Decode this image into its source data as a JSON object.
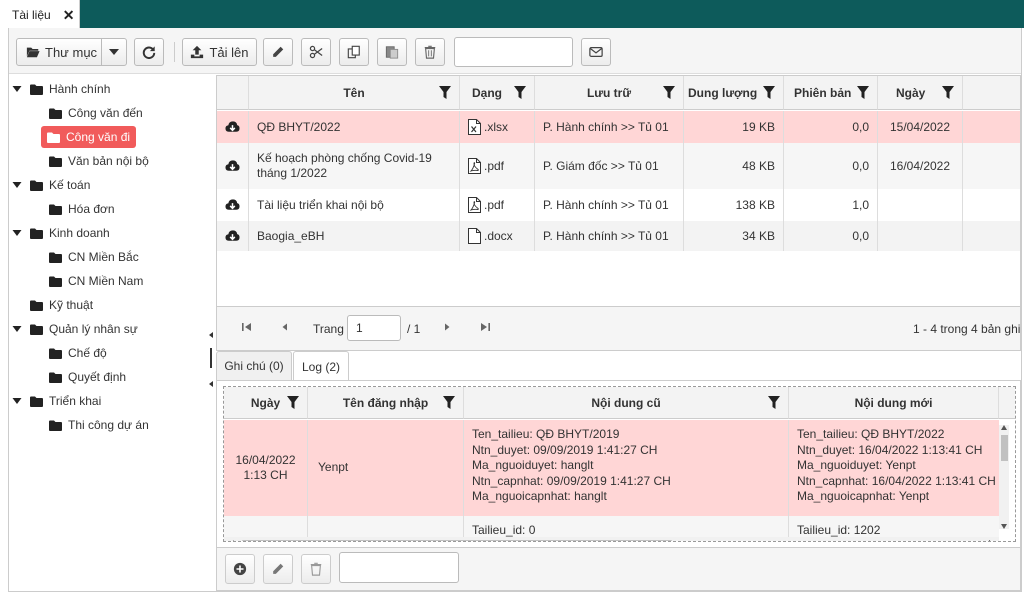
{
  "window": {
    "tab_label": "Tài liệu"
  },
  "toolbar": {
    "folder_label": "Thư mục",
    "upload_label": "Tải lên",
    "search_value": ""
  },
  "tree": [
    {
      "label": "Hành chính",
      "level": 0,
      "expanded": true
    },
    {
      "label": "Công văn đến",
      "level": 1
    },
    {
      "label": "Công văn đi",
      "level": 1,
      "selected": true
    },
    {
      "label": "Văn bản nội bộ",
      "level": 1
    },
    {
      "label": "Kế toán",
      "level": 0,
      "expanded": true
    },
    {
      "label": "Hóa đơn",
      "level": 1
    },
    {
      "label": "Kinh doanh",
      "level": 0,
      "expanded": true
    },
    {
      "label": "CN Miền Bắc",
      "level": 1
    },
    {
      "label": "CN Miền Nam",
      "level": 1
    },
    {
      "label": "Kỹ thuật",
      "level": 0,
      "expanded": false
    },
    {
      "label": "Quản lý nhân sự",
      "level": 0,
      "expanded": true
    },
    {
      "label": "Chế độ",
      "level": 1
    },
    {
      "label": "Quyết định",
      "level": 1
    },
    {
      "label": "Triển khai",
      "level": 0,
      "expanded": true
    },
    {
      "label": "Thi công dự án",
      "level": 1
    }
  ],
  "docgrid": {
    "columns": [
      "Tên",
      "Dạng",
      "Lưu trữ",
      "Dung lượng",
      "Phiên bản",
      "Ngày"
    ],
    "rows": [
      {
        "name": "QĐ BHYT/2022",
        "type": ".xlsx",
        "icon": "excel-file-icon",
        "storage": "P. Hành chính >> Tủ 01",
        "size": "19 KB",
        "version": "0,0",
        "date": "15/04/2022",
        "highlight": true
      },
      {
        "name": "Kế hoạch phòng chống Covid-19 tháng 1/2022",
        "type": ".pdf",
        "icon": "pdf-file-icon",
        "storage": "P. Giám đốc >> Tủ 01",
        "size": "48 KB",
        "version": "0,0",
        "date": "16/04/2022"
      },
      {
        "name": "Tài liệu triển khai nội bộ",
        "type": ".pdf",
        "icon": "pdf-file-icon",
        "storage": "P. Hành chính >> Tủ 01",
        "size": "138 KB",
        "version": "1,0",
        "date": ""
      },
      {
        "name": "Baogia_eBH",
        "type": ".docx",
        "icon": "doc-file-icon",
        "storage": "P. Hành chính >> Tủ 01",
        "size": "34 KB",
        "version": "0,0",
        "date": ""
      }
    ]
  },
  "pager": {
    "page_label": "Trang",
    "page_value": "1",
    "total_pages": "/ 1",
    "summary": "1 - 4 trong 4 bản ghi"
  },
  "lower_tabs": [
    "Ghi chú (0)",
    "Log (2)"
  ],
  "loggrid": {
    "columns": [
      "Ngày",
      "Tên đăng nhập",
      "Nội dung cũ",
      "Nội dung mới"
    ],
    "rows": [
      {
        "date": "16/04/2022",
        "time": "1:13 CH",
        "user": "Yenpt",
        "old": [
          "Ten_tailieu: QĐ BHYT/2019",
          "Ntn_duyet: 09/09/2019 1:41:27 CH",
          "Ma_nguoiduyet: hanglt",
          "Ntn_capnhat: 09/09/2019 1:41:27 CH",
          "Ma_nguoicapnhat: hanglt"
        ],
        "new": [
          "Ten_tailieu: QĐ BHYT/2022",
          "Ntn_duyet: 16/04/2022 1:13:41 CH",
          "Ma_nguoiduyet: Yenpt",
          "Ntn_capnhat: 16/04/2022 1:13:41 CH",
          "Ma_nguoicapnhat: Yenpt"
        ]
      },
      {
        "date": "",
        "time": "",
        "user": "",
        "old": [
          "Tailieu_id: 0"
        ],
        "new": [
          "Tailieu_id: 1202"
        ]
      }
    ]
  },
  "bottombar": {
    "input_value": ""
  },
  "colors": {
    "accent": "#0d5b5b",
    "selected": "#f15b5b",
    "row_highlight": "#ffd6d6"
  }
}
